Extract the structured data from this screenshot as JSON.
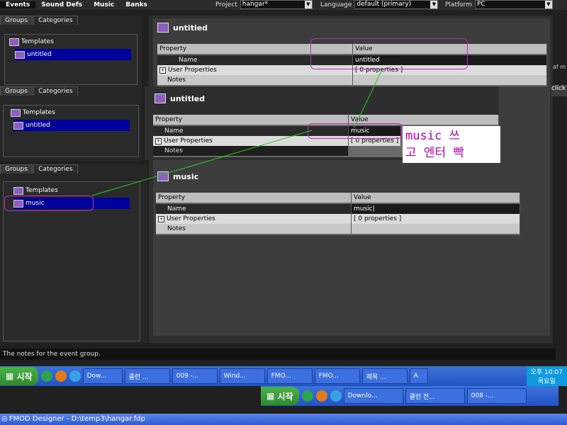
{
  "menubar": {
    "items": [
      "Events",
      "Sound Defs",
      "Music",
      "Banks"
    ],
    "project_label": "Project",
    "project_value": "hangar*",
    "language_label": "Language",
    "language_value": "default (primary)",
    "platform_label": "Platform",
    "platform_value": "PC"
  },
  "left_tabs": {
    "groups": "Groups",
    "categories": "Categories"
  },
  "trees": [
    {
      "templates": "Templates",
      "selected": "untitled"
    },
    {
      "templates": "Templates",
      "selected": "untitled"
    },
    {
      "templates": "Templates",
      "selected": "music"
    }
  ],
  "panels": [
    {
      "title": "untitled",
      "name_value": "untitled"
    },
    {
      "title": "untitled",
      "name_value": "music"
    },
    {
      "title": "music",
      "name_value": "music|"
    }
  ],
  "grid": {
    "col_property": "Property",
    "col_value": "Value",
    "row_name": "Name",
    "row_user_props": "User Properties",
    "user_props_value": "[ 0 properties ]",
    "row_notes": "Notes"
  },
  "annotation": {
    "line1": "music 쓰",
    "line2": "고 엔터 빡"
  },
  "edge": {
    "text1": "af m",
    "text2": "click"
  },
  "status_text": "The notes for the event group.",
  "taskbar1": {
    "start": "시작",
    "buttons": [
      "Dow...",
      "클런 ...",
      "009 -...",
      "Wind...",
      "FMO...",
      "FMO...",
      "제목 ..."
    ],
    "clock": "오후 10:07",
    "day": "목요일"
  },
  "taskbar2": {
    "start": "시작",
    "buttons": [
      "Downlo...",
      "클런 전...",
      "008 -..."
    ]
  },
  "window_title": "FMOD Designer - D:\\temp3\\hangar.fdp",
  "colors": {
    "selection": "#00009c",
    "annotation": "#c02cc0",
    "connector": "#22cc22"
  }
}
